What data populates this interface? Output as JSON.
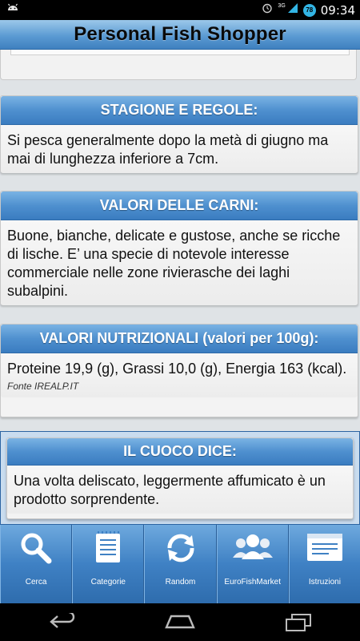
{
  "status_bar": {
    "time": "09:34",
    "network": "3G",
    "battery": "78",
    "icons": [
      "android-icon",
      "alarm-icon",
      "signal-icon",
      "battery-icon"
    ]
  },
  "app": {
    "title": "Personal Fish Shopper"
  },
  "sections": {
    "stagione": {
      "header": "STAGIONE E REGOLE:",
      "body": "Si pesca generalmente dopo la metà di giugno ma mai di lunghezza inferiore a 7cm."
    },
    "carni": {
      "header": "VALORI DELLE CARNI:",
      "body": "Buone, bianche, delicate e gustose, anche se ricche di lische. E’ una specie di notevole interesse commerciale nelle zone rivierasche dei laghi subalpini."
    },
    "nutrizionali": {
      "header": "VALORI NUTRIZIONALI (valori per 100g):",
      "body": "Proteine 19,9 (g), Grassi 10,0 (g), Energia 163 (kcal).",
      "source": "Fonte IREALP.IT"
    },
    "cuoco": {
      "header": "IL CUOCO DICE:",
      "body": "Una volta deliscato, leggermente affumicato è un prodotto sorprendente."
    }
  },
  "tabs": [
    {
      "label": "Cerca",
      "icon": "search-icon"
    },
    {
      "label": "Categorie",
      "icon": "list-icon"
    },
    {
      "label": "Random",
      "icon": "refresh-icon"
    },
    {
      "label": "EuroFishMarket",
      "icon": "users-icon"
    },
    {
      "label": "Istruzioni",
      "icon": "instructions-icon"
    }
  ],
  "colors": {
    "header_blue": "#4f90cf",
    "tab_blue": "#3f81c4",
    "card_bg": "#f3f3f3",
    "status_accent": "#33b5e5"
  }
}
